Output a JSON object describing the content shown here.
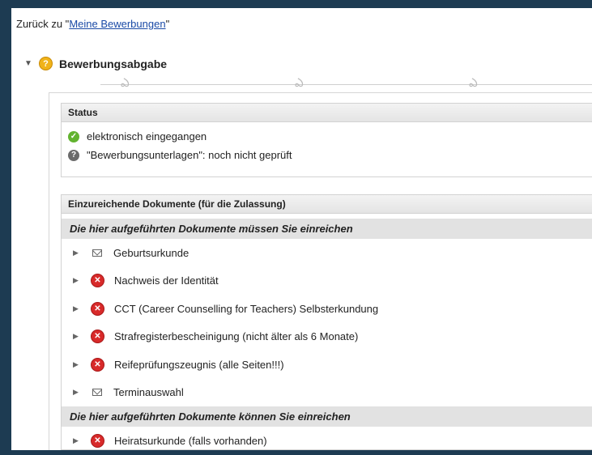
{
  "back": {
    "prefix": "Zurück zu \"",
    "link": "Meine Bewerbungen",
    "suffix": "\""
  },
  "section": {
    "title": "Bewerbungsabgabe"
  },
  "status": {
    "header": "Status",
    "rows": [
      {
        "icon": "check-icon",
        "text": "elektronisch eingegangen"
      },
      {
        "icon": "question-icon",
        "text": "\"Bewerbungsunterlagen\": noch nicht geprüft"
      }
    ]
  },
  "documents": {
    "header": "Einzureichende Dokumente (für die Zulassung)",
    "required_header": "Die hier aufgeführten Dokumente müssen Sie einreichen",
    "required": [
      {
        "icon": "mail-icon",
        "label": "Geburtsurkunde"
      },
      {
        "icon": "error-icon",
        "label": "Nachweis der Identität"
      },
      {
        "icon": "error-icon",
        "label": "CCT (Career Counselling for Teachers) Selbsterkundung"
      },
      {
        "icon": "error-icon",
        "label": "Strafregisterbescheinigung (nicht älter als 6 Monate)"
      },
      {
        "icon": "error-icon",
        "label": "Reifeprüfungszeugnis (alle Seiten!!!)"
      },
      {
        "icon": "mail-icon",
        "label": "Terminauswahl"
      }
    ],
    "optional_header": "Die hier aufgeführten Dokumente können Sie einreichen",
    "optional": [
      {
        "icon": "error-icon",
        "label": "Heiratsurkunde (falls vorhanden)"
      }
    ]
  }
}
